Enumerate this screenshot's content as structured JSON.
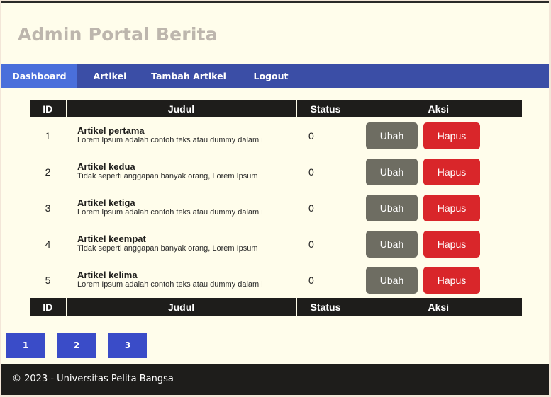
{
  "header": {
    "title": "Admin Portal Berita"
  },
  "nav": {
    "items": [
      {
        "label": "Dashboard",
        "active": true
      },
      {
        "label": "Artikel",
        "active": false
      },
      {
        "label": "Tambah Artikel",
        "active": false
      },
      {
        "label": "Logout",
        "active": false
      }
    ]
  },
  "table": {
    "headers": [
      "ID",
      "Judul",
      "Status",
      "Aksi"
    ],
    "rows": [
      {
        "id": "1",
        "title": "Artikel pertama",
        "excerpt": "Lorem Ipsum adalah contoh teks atau dummy dalam i",
        "status": "0"
      },
      {
        "id": "2",
        "title": "Artikel kedua",
        "excerpt": "Tidak seperti anggapan banyak orang, Lorem Ipsum",
        "status": "0"
      },
      {
        "id": "3",
        "title": "Artikel ketiga",
        "excerpt": "Lorem Ipsum adalah contoh teks atau dummy dalam i",
        "status": "0"
      },
      {
        "id": "4",
        "title": "Artikel keempat",
        "excerpt": "Tidak seperti anggapan banyak orang, Lorem Ipsum",
        "status": "0"
      },
      {
        "id": "5",
        "title": "Artikel kelima",
        "excerpt": "Lorem Ipsum adalah contoh teks atau dummy dalam i",
        "status": "0"
      }
    ],
    "edit_label": "Ubah",
    "delete_label": "Hapus"
  },
  "pagination": {
    "pages": [
      "1",
      "2",
      "3"
    ]
  },
  "footer": {
    "text": "© 2023 - Universitas Pelita Bangsa"
  },
  "colors": {
    "nav_bg": "#3b4ea6",
    "nav_active": "#4a6fdb",
    "table_header": "#1e1d1b",
    "edit_button": "#6e6d62",
    "delete_button": "#d9262a",
    "page_button": "#3a4cc8",
    "page_bg": "#fffdeb"
  }
}
